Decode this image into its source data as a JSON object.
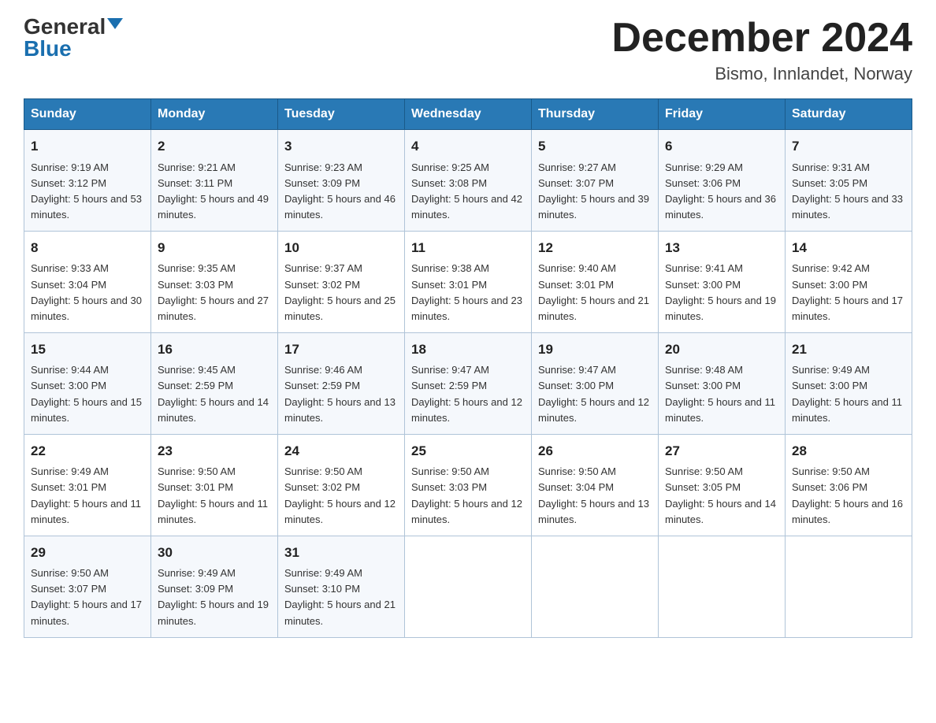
{
  "logo": {
    "general": "General",
    "blue": "Blue"
  },
  "title": "December 2024",
  "location": "Bismo, Innlandet, Norway",
  "days_of_week": [
    "Sunday",
    "Monday",
    "Tuesday",
    "Wednesday",
    "Thursday",
    "Friday",
    "Saturday"
  ],
  "weeks": [
    [
      {
        "day": "1",
        "sunrise": "9:19 AM",
        "sunset": "3:12 PM",
        "daylight": "5 hours and 53 minutes."
      },
      {
        "day": "2",
        "sunrise": "9:21 AM",
        "sunset": "3:11 PM",
        "daylight": "5 hours and 49 minutes."
      },
      {
        "day": "3",
        "sunrise": "9:23 AM",
        "sunset": "3:09 PM",
        "daylight": "5 hours and 46 minutes."
      },
      {
        "day": "4",
        "sunrise": "9:25 AM",
        "sunset": "3:08 PM",
        "daylight": "5 hours and 42 minutes."
      },
      {
        "day": "5",
        "sunrise": "9:27 AM",
        "sunset": "3:07 PM",
        "daylight": "5 hours and 39 minutes."
      },
      {
        "day": "6",
        "sunrise": "9:29 AM",
        "sunset": "3:06 PM",
        "daylight": "5 hours and 36 minutes."
      },
      {
        "day": "7",
        "sunrise": "9:31 AM",
        "sunset": "3:05 PM",
        "daylight": "5 hours and 33 minutes."
      }
    ],
    [
      {
        "day": "8",
        "sunrise": "9:33 AM",
        "sunset": "3:04 PM",
        "daylight": "5 hours and 30 minutes."
      },
      {
        "day": "9",
        "sunrise": "9:35 AM",
        "sunset": "3:03 PM",
        "daylight": "5 hours and 27 minutes."
      },
      {
        "day": "10",
        "sunrise": "9:37 AM",
        "sunset": "3:02 PM",
        "daylight": "5 hours and 25 minutes."
      },
      {
        "day": "11",
        "sunrise": "9:38 AM",
        "sunset": "3:01 PM",
        "daylight": "5 hours and 23 minutes."
      },
      {
        "day": "12",
        "sunrise": "9:40 AM",
        "sunset": "3:01 PM",
        "daylight": "5 hours and 21 minutes."
      },
      {
        "day": "13",
        "sunrise": "9:41 AM",
        "sunset": "3:00 PM",
        "daylight": "5 hours and 19 minutes."
      },
      {
        "day": "14",
        "sunrise": "9:42 AM",
        "sunset": "3:00 PM",
        "daylight": "5 hours and 17 minutes."
      }
    ],
    [
      {
        "day": "15",
        "sunrise": "9:44 AM",
        "sunset": "3:00 PM",
        "daylight": "5 hours and 15 minutes."
      },
      {
        "day": "16",
        "sunrise": "9:45 AM",
        "sunset": "2:59 PM",
        "daylight": "5 hours and 14 minutes."
      },
      {
        "day": "17",
        "sunrise": "9:46 AM",
        "sunset": "2:59 PM",
        "daylight": "5 hours and 13 minutes."
      },
      {
        "day": "18",
        "sunrise": "9:47 AM",
        "sunset": "2:59 PM",
        "daylight": "5 hours and 12 minutes."
      },
      {
        "day": "19",
        "sunrise": "9:47 AM",
        "sunset": "3:00 PM",
        "daylight": "5 hours and 12 minutes."
      },
      {
        "day": "20",
        "sunrise": "9:48 AM",
        "sunset": "3:00 PM",
        "daylight": "5 hours and 11 minutes."
      },
      {
        "day": "21",
        "sunrise": "9:49 AM",
        "sunset": "3:00 PM",
        "daylight": "5 hours and 11 minutes."
      }
    ],
    [
      {
        "day": "22",
        "sunrise": "9:49 AM",
        "sunset": "3:01 PM",
        "daylight": "5 hours and 11 minutes."
      },
      {
        "day": "23",
        "sunrise": "9:50 AM",
        "sunset": "3:01 PM",
        "daylight": "5 hours and 11 minutes."
      },
      {
        "day": "24",
        "sunrise": "9:50 AM",
        "sunset": "3:02 PM",
        "daylight": "5 hours and 12 minutes."
      },
      {
        "day": "25",
        "sunrise": "9:50 AM",
        "sunset": "3:03 PM",
        "daylight": "5 hours and 12 minutes."
      },
      {
        "day": "26",
        "sunrise": "9:50 AM",
        "sunset": "3:04 PM",
        "daylight": "5 hours and 13 minutes."
      },
      {
        "day": "27",
        "sunrise": "9:50 AM",
        "sunset": "3:05 PM",
        "daylight": "5 hours and 14 minutes."
      },
      {
        "day": "28",
        "sunrise": "9:50 AM",
        "sunset": "3:06 PM",
        "daylight": "5 hours and 16 minutes."
      }
    ],
    [
      {
        "day": "29",
        "sunrise": "9:50 AM",
        "sunset": "3:07 PM",
        "daylight": "5 hours and 17 minutes."
      },
      {
        "day": "30",
        "sunrise": "9:49 AM",
        "sunset": "3:09 PM",
        "daylight": "5 hours and 19 minutes."
      },
      {
        "day": "31",
        "sunrise": "9:49 AM",
        "sunset": "3:10 PM",
        "daylight": "5 hours and 21 minutes."
      },
      null,
      null,
      null,
      null
    ]
  ],
  "labels": {
    "sunrise": "Sunrise:",
    "sunset": "Sunset:",
    "daylight": "Daylight:"
  }
}
